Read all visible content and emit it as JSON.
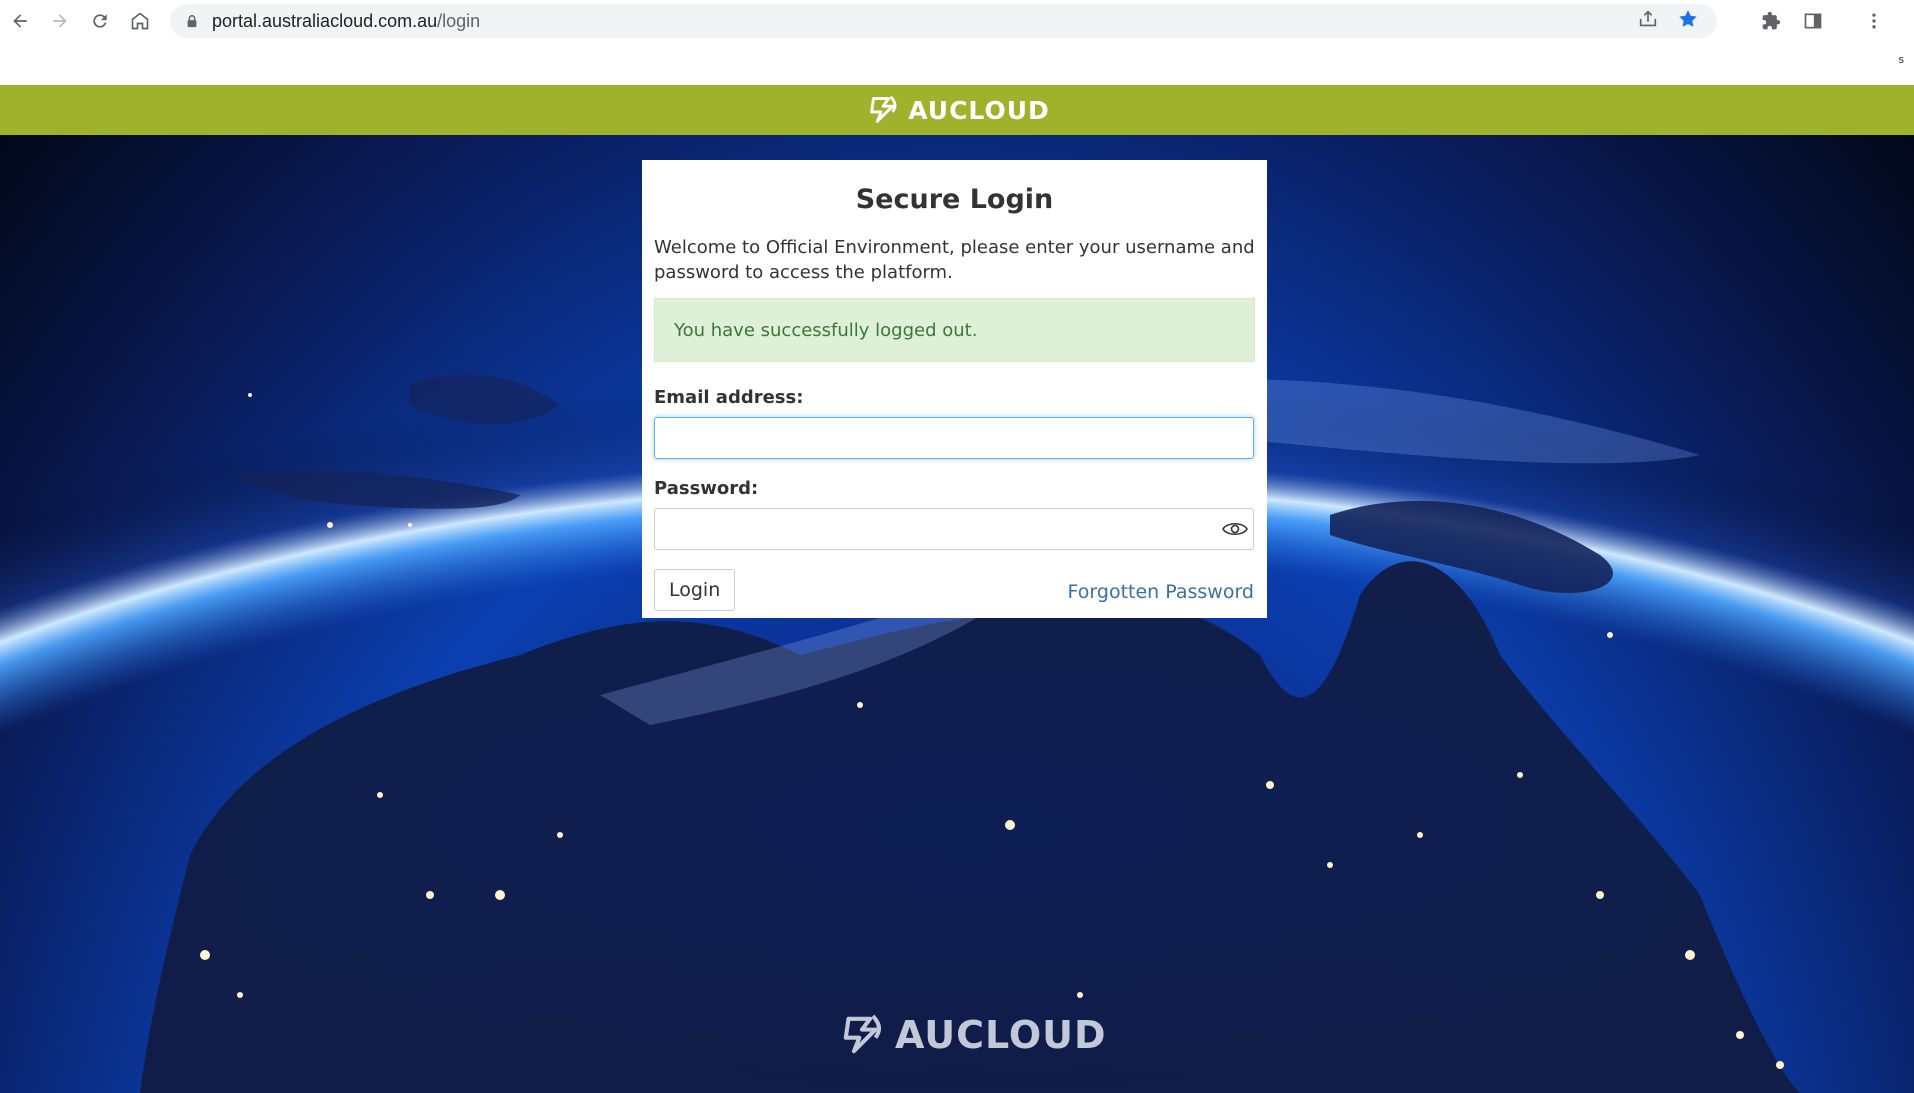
{
  "browser": {
    "url_host": "portal.australiacloud.com.au",
    "url_path": "/login",
    "corner_char": "s"
  },
  "header": {
    "brand": "AUCLOUD"
  },
  "login": {
    "title": "Secure Login",
    "description": "Welcome to Official Environment, please enter your username and password to access the platform.",
    "alert": "You have successfully logged out.",
    "email_label": "Email address:",
    "email_value": "",
    "password_label": "Password:",
    "password_value": "",
    "login_button": "Login",
    "forgot_link": "Forgotten Password"
  },
  "footer": {
    "brand": "AUCLOUD"
  },
  "colors": {
    "brand_green": "#9eb22b",
    "link_blue": "#3a6fa8",
    "alert_bg": "#dff0d8",
    "alert_text": "#3c763d"
  }
}
